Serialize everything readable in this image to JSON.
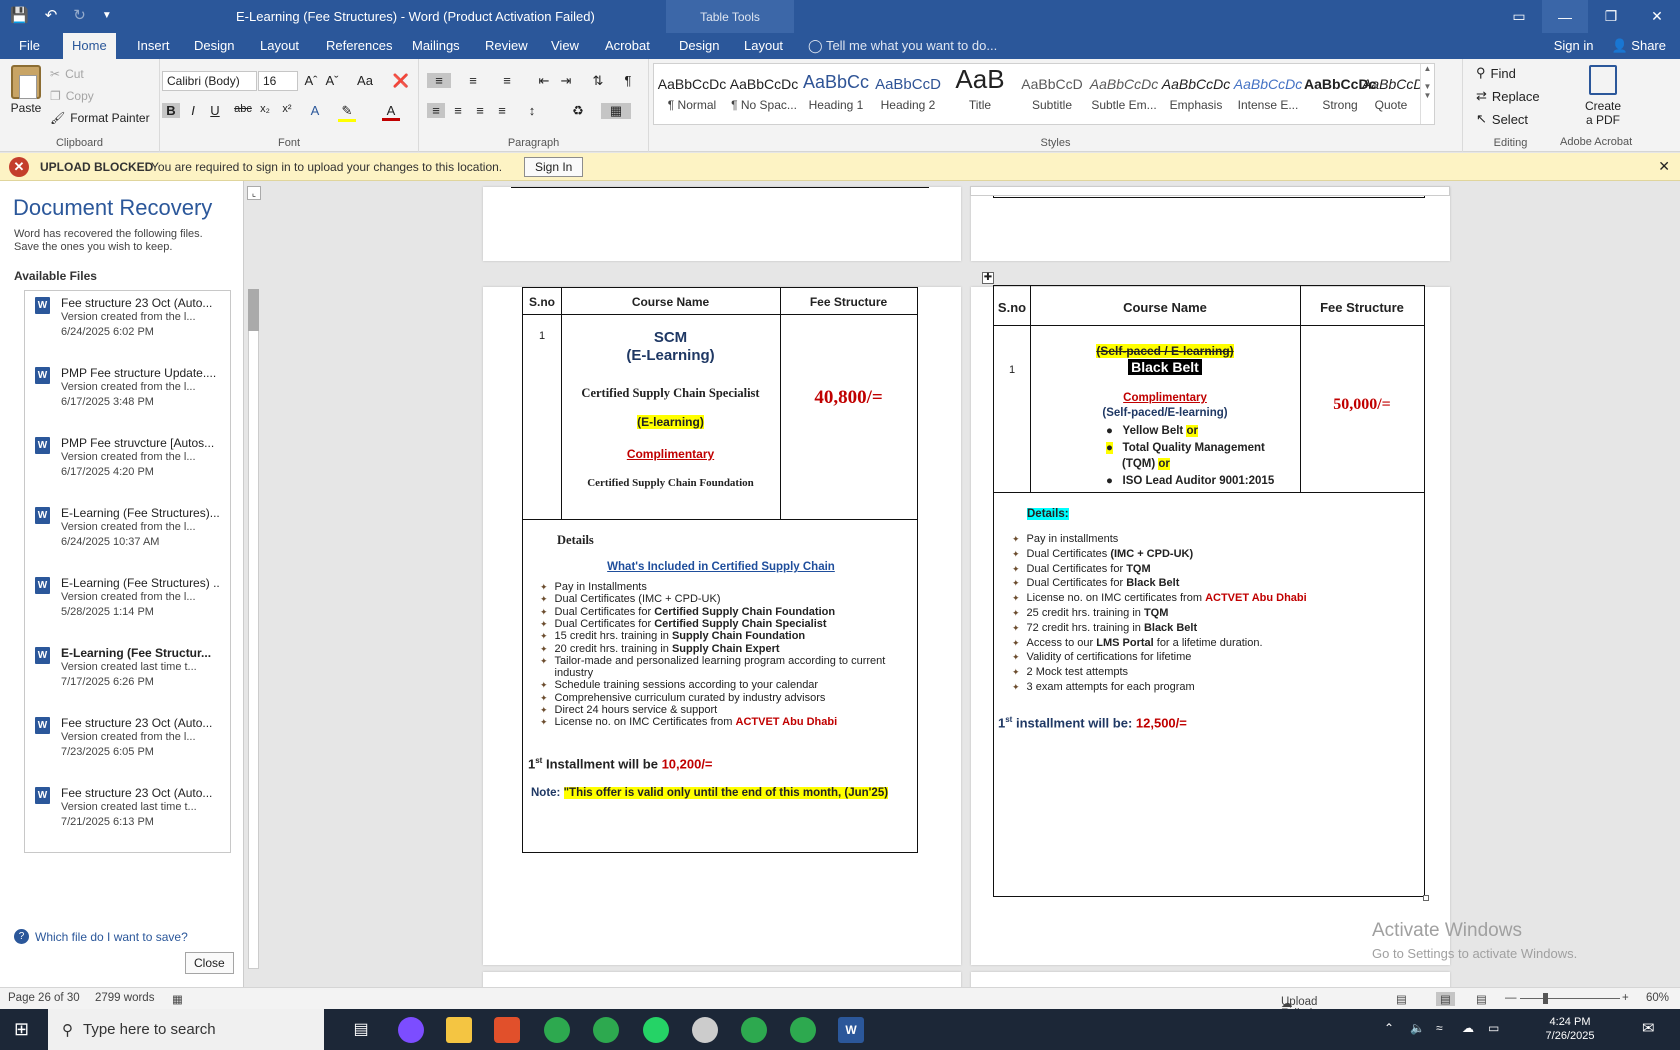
{
  "window": {
    "title": "E-Learning (Fee Structures) - Word (Product Activation Failed)",
    "table_tools": "Table Tools"
  },
  "tabs": [
    "File",
    "Home",
    "Insert",
    "Design",
    "Layout",
    "References",
    "Mailings",
    "Review",
    "View",
    "Acrobat",
    "Design",
    "Layout"
  ],
  "tell_me": "Tell me what you want to do...",
  "sign_in": "Sign in",
  "share": "Share",
  "ribbon": {
    "clipboard": {
      "paste": "Paste",
      "cut": "Cut",
      "copy": "Copy",
      "format_painter": "Format Painter",
      "label": "Clipboard"
    },
    "font": {
      "name": "Calibri (Body)",
      "size": "16",
      "label": "Font"
    },
    "paragraph": {
      "label": "Paragraph"
    },
    "styles": {
      "items": [
        {
          "preview": "AaBbCcDc",
          "name": "¶ Normal"
        },
        {
          "preview": "AaBbCcDc",
          "name": "¶ No Spac..."
        },
        {
          "preview": "AaBbCc",
          "name": "Heading 1"
        },
        {
          "preview": "AaBbCcD",
          "name": "Heading 2"
        },
        {
          "preview": "AaB",
          "name": "Title"
        },
        {
          "preview": "AaBbCcD",
          "name": "Subtitle"
        },
        {
          "preview": "AaBbCcDc",
          "name": "Subtle Em..."
        },
        {
          "preview": "AaBbCcDc",
          "name": "Emphasis"
        },
        {
          "preview": "AaBbCcDc",
          "name": "Intense E..."
        },
        {
          "preview": "AaBbCcDc",
          "name": "Strong"
        },
        {
          "preview": "AaBbCcDc",
          "name": "Quote"
        }
      ],
      "label": "Styles"
    },
    "editing": {
      "find": "Find",
      "replace": "Replace",
      "select": "Select",
      "label": "Editing"
    },
    "acrobat": {
      "create": "Create",
      "pdf": "a PDF",
      "label": "Adobe Acrobat"
    }
  },
  "message_bar": {
    "title": "UPLOAD BLOCKED",
    "text": "You are required to sign in to upload your changes to this location.",
    "button": "Sign In"
  },
  "recovery": {
    "title": "Document Recovery",
    "subtitle_1": "Word has recovered the following files.",
    "subtitle_2": "Save the ones you wish to keep.",
    "available": "Available Files",
    "files": [
      {
        "name": "Fee structure 23 Oct (Auto...",
        "version": "Version created from the l...",
        "date": "6/24/2025 6:02 PM",
        "bold": false
      },
      {
        "name": "PMP Fee structure Update....",
        "version": "Version created from the l...",
        "date": "6/17/2025 3:48 PM",
        "bold": false
      },
      {
        "name": "PMP Fee struvcture  [Autos...",
        "version": "Version created from the l...",
        "date": "6/17/2025 4:20 PM",
        "bold": false
      },
      {
        "name": "E-Learning (Fee Structures)...",
        "version": "Version created from the l...",
        "date": "6/24/2025 10:37 AM",
        "bold": false
      },
      {
        "name": "E-Learning (Fee Structures) ..",
        "version": "Version created from the l...",
        "date": "5/28/2025 1:14 PM",
        "bold": false
      },
      {
        "name": "E-Learning (Fee Structur...",
        "version": "Version created last time t...",
        "date": "7/17/2025 6:26 PM",
        "bold": true
      },
      {
        "name": "Fee structure 23 Oct (Auto...",
        "version": "Version created from the l...",
        "date": "7/23/2025 6:05 PM",
        "bold": false
      },
      {
        "name": "Fee structure 23 Oct (Auto...",
        "version": "Version created last time t...",
        "date": "7/21/2025 6:13 PM",
        "bold": false
      }
    ],
    "which": "Which file do I want to save?",
    "close": "Close"
  },
  "left_table": {
    "headers": [
      "S.no",
      "Course Name",
      "Fee Structure"
    ],
    "sno": "1",
    "course_title_1": "SCM",
    "course_title_2": "(E-Learning)",
    "cert": "Certified Supply Chain Specialist",
    "elearn": "(E-learning)",
    "compl": "Complimentary",
    "foundation": "Certified Supply Chain Foundation",
    "fee": "40,800/=",
    "details": "Details",
    "whats_included": "What's Included in Certified Supply Chain",
    "bullets": [
      {
        "pre": "Pay in Installments",
        "bold": "",
        "red": ""
      },
      {
        "pre": "Dual Certificates (IMC + CPD-UK)",
        "bold": "",
        "red": ""
      },
      {
        "pre": "Dual Certificates for ",
        "bold": "Certified Supply Chain Foundation",
        "red": ""
      },
      {
        "pre": "Dual Certificates for ",
        "bold": "Certified Supply Chain Specialist",
        "red": ""
      },
      {
        "pre": "15 credit hrs. training in ",
        "bold": "Supply Chain Foundation",
        "red": ""
      },
      {
        "pre": "20 credit hrs. training in ",
        "bold": "Supply Chain Expert",
        "red": ""
      },
      {
        "pre": "Tailor-made and personalized learning program according to current",
        "bold": "",
        "red": ""
      },
      {
        "pre": "industry",
        "bold": "",
        "red": ""
      },
      {
        "pre": "Schedule training sessions according to your calendar",
        "bold": "",
        "red": ""
      },
      {
        "pre": "Comprehensive curriculum curated by industry advisors",
        "bold": "",
        "red": ""
      },
      {
        "pre": "Direct 24 hours service & support",
        "bold": "",
        "red": ""
      },
      {
        "pre": "License no. on IMC Certificates from ",
        "bold": "",
        "red": "ACTVET Abu Dhabi"
      }
    ],
    "installment_pre": "1",
    "installment_sup": "st",
    "installment_text": " Installment will be ",
    "installment_val": "10,200/=",
    "note_label": "Note: ",
    "note_text": "\"This offer is valid only until the end of this month, (Jun'25)"
  },
  "right_table": {
    "headers": [
      "S.no",
      "Course Name",
      "Fee Structure"
    ],
    "sno": "1",
    "paced": "(Self-paced / E-learning)",
    "belt": "Black Belt",
    "compl": "Complimentary",
    "paced2": "(Self-paced/E-learning)",
    "opt1": "Yellow Belt ",
    "opt2": "Total Quality Management",
    "opt2b": "(TQM) ",
    "or": "or",
    "opt3": "ISO Lead Auditor 9001:2015",
    "fee": "50,000/=",
    "details": "Details:",
    "bullets": [
      {
        "pre": "Pay in installments",
        "bold": "",
        "red": ""
      },
      {
        "pre": "Dual Certificates ",
        "bold": "(IMC + CPD-UK)",
        "red": ""
      },
      {
        "pre": "Dual Certificates for ",
        "bold": "TQM",
        "red": ""
      },
      {
        "pre": "Dual Certificates for ",
        "bold": "Black Belt",
        "red": ""
      },
      {
        "pre": "License no. on IMC certificates from ",
        "bold": "",
        "red": "ACTVET Abu Dhabi"
      },
      {
        "pre": "25 credit hrs. training in ",
        "bold": "TQM",
        "red": ""
      },
      {
        "pre": "72 credit hrs. training in ",
        "bold": "Black Belt",
        "red": ""
      },
      {
        "pre": "Access to our ",
        "bold": "LMS Portal",
        "red": "",
        "post": " for a lifetime duration."
      },
      {
        "pre": "Validity of certifications for lifetime",
        "bold": "",
        "red": ""
      },
      {
        "pre": "2 Mock test attempts",
        "bold": "",
        "red": ""
      },
      {
        "pre": "3 exam attempts for each program",
        "bold": "",
        "red": ""
      }
    ],
    "installment_pre": "1",
    "installment_sup": "st",
    "installment_text": " installment will be: ",
    "installment_val": "12,500/="
  },
  "watermark": {
    "line1": "Activate Windows",
    "line2": "Go to Settings to activate Windows."
  },
  "status": {
    "page": "Page 26 of 30",
    "words": "2799 words",
    "upload": "Upload Failed",
    "zoom": "60%"
  },
  "taskbar": {
    "search": "Type here to search",
    "time": "4:24 PM",
    "date": "7/26/2025"
  }
}
